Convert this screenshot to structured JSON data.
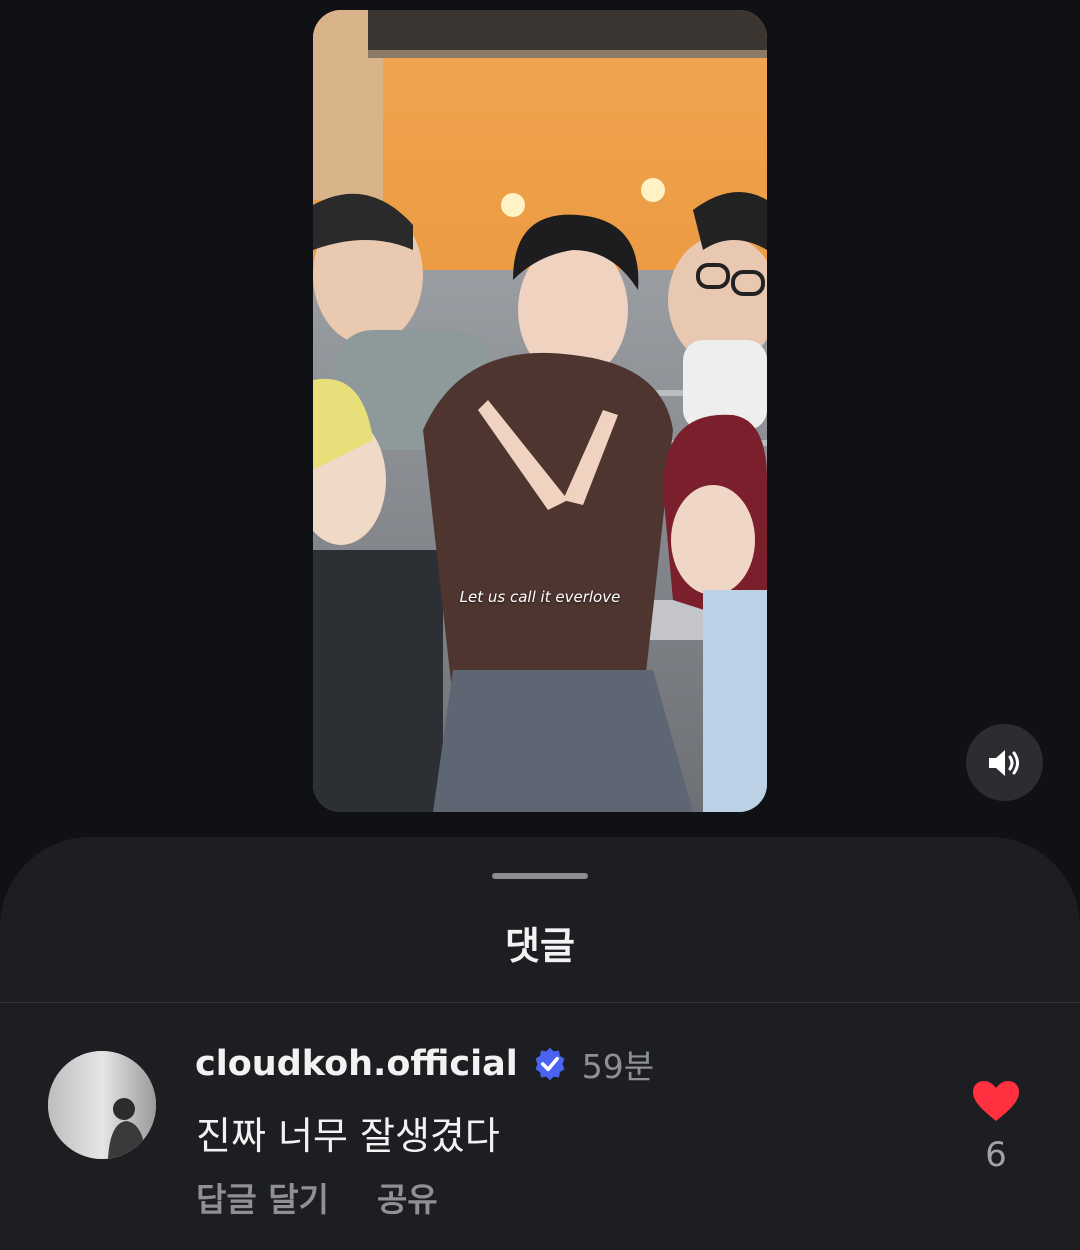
{
  "video": {
    "caption": "Let us call it everlove"
  },
  "controls": {
    "sound_icon": "speaker-on-icon"
  },
  "sheet": {
    "title": "댓글"
  },
  "comment": {
    "username": "cloudkoh.official",
    "verified_icon": "verified-badge-icon",
    "time": "59분",
    "text": "진짜 너무 잘생겼다",
    "actions": {
      "reply": "답글 달기",
      "share": "공유"
    },
    "like_icon": "heart-filled-icon",
    "likes": "6"
  },
  "colors": {
    "background": "#101114",
    "sheet": "#1c1e21",
    "verified": "#4a63f0",
    "like": "#ff3040"
  }
}
